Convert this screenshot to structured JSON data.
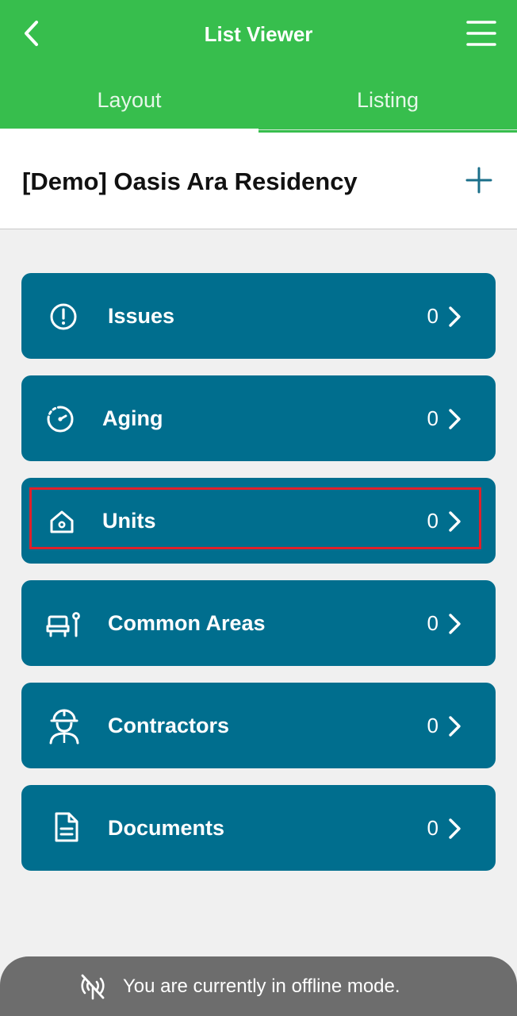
{
  "header": {
    "title": "List Viewer",
    "back_icon": "chevron-left-icon",
    "menu_icon": "hamburger-menu-icon",
    "color": "#37be4d"
  },
  "tabs": [
    {
      "label": "Layout",
      "selected": true
    },
    {
      "label": "Listing",
      "selected": false
    }
  ],
  "project": {
    "name": "[Demo] Oasis Ara Residency",
    "add_icon": "plus-icon"
  },
  "categories": [
    {
      "label": "Issues",
      "count": "0",
      "icon": "alert-circle-icon"
    },
    {
      "label": "Aging",
      "count": "0",
      "icon": "aging-clock-icon"
    },
    {
      "label": "Units",
      "count": "0",
      "icon": "home-icon",
      "highlighted": true
    },
    {
      "label": "Common Areas",
      "count": "0",
      "icon": "common-areas-icon"
    },
    {
      "label": "Contractors",
      "count": "0",
      "icon": "contractor-icon"
    },
    {
      "label": "Documents",
      "count": "0",
      "icon": "document-icon"
    }
  ],
  "card_color": "#006e8e",
  "offline_banner": {
    "text": "You are currently in offline mode.",
    "icon": "no-signal-icon"
  }
}
